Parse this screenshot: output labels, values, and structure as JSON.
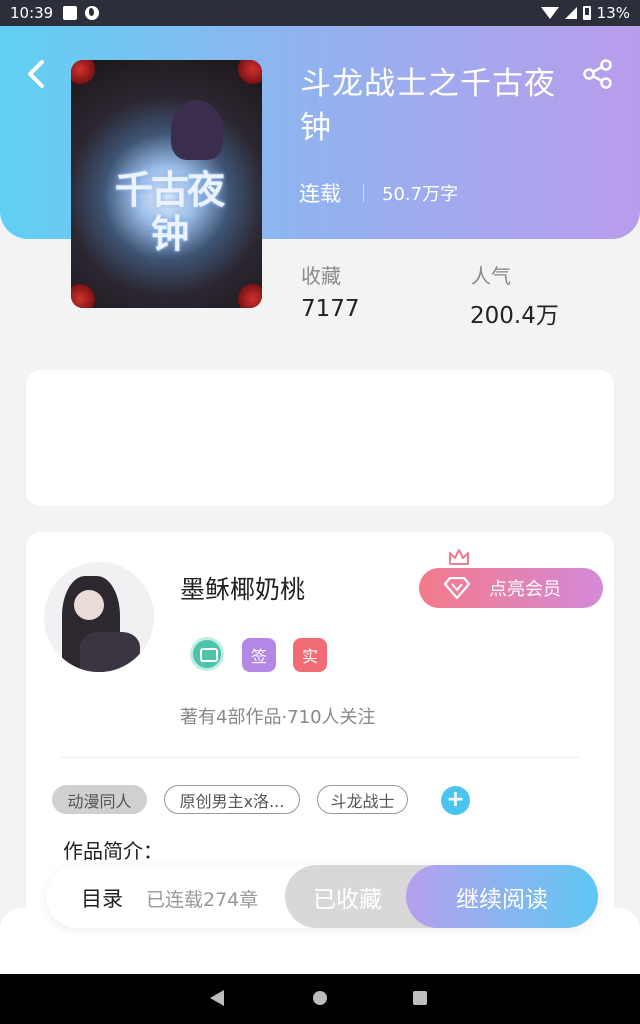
{
  "status_bar": {
    "time": "10:39",
    "battery": "13%"
  },
  "book": {
    "title": "斗龙战士之千古夜钟",
    "status": "连载",
    "word_count": "50.7万字",
    "cover_text": "千古夜钟",
    "stats": [
      {
        "label": "收藏",
        "value": "7177"
      },
      {
        "label": "人气",
        "value": "200.4万"
      }
    ]
  },
  "author": {
    "name": "墨稣椰奶桃",
    "badges": [
      "签",
      "实"
    ],
    "meta": "著有4部作品·710人关注",
    "vip_button": "点亮会员"
  },
  "tags": [
    "动漫同人",
    "原创男主x洛...",
    "斗龙战士"
  ],
  "intro_label": "作品简介：",
  "action_bar": {
    "toc": "目录",
    "chapter_count": "已连载274章",
    "collected": "已收藏",
    "continue": "继续阅读"
  },
  "colors": {
    "header_gradient_start": "#5fd0f3",
    "header_gradient_end": "#b99cec",
    "vip_gradient_start": "#f47a8a",
    "vip_gradient_end": "#d38ad8",
    "read_gradient_start": "#b6a0ee",
    "read_gradient_end": "#5ec7f3",
    "badge_sign": "#b387e6",
    "badge_real": "#f26c76"
  }
}
